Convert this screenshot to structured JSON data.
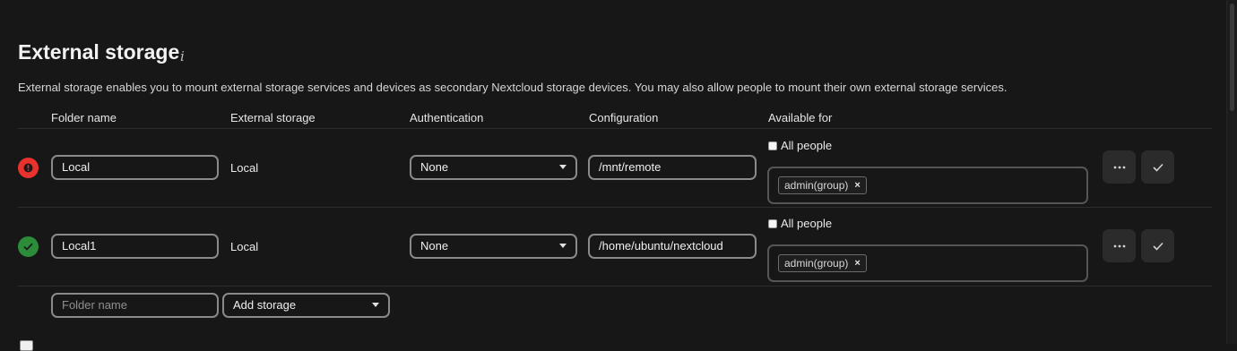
{
  "section": {
    "title": "External storage",
    "info_icon": "i",
    "description": "External storage enables you to mount external storage services and devices as secondary Nextcloud storage devices. You may also allow people to mount their own external storage services."
  },
  "columns": {
    "folder": "Folder name",
    "storage": "External storage",
    "auth": "Authentication",
    "config": "Configuration",
    "available": "Available for"
  },
  "mounts": [
    {
      "status": "error",
      "status_icon": "exclamation-icon",
      "folder_name": "Local",
      "storage_type": "Local",
      "authentication": "None",
      "configuration": "/mnt/remote",
      "all_people_label": "All people",
      "all_people_checked": false,
      "applicable": [
        "admin(group)"
      ],
      "remove_tag": "×"
    },
    {
      "status": "ok",
      "status_icon": "checkmark-icon",
      "folder_name": "Local1",
      "storage_type": "Local",
      "authentication": "None",
      "configuration": "/home/ubuntu/nextcloud",
      "all_people_label": "All people",
      "all_people_checked": false,
      "applicable": [
        "admin(group)"
      ],
      "remove_tag": "×"
    }
  ],
  "new_mount": {
    "folder_placeholder": "Folder name",
    "add_storage_label": "Add storage"
  },
  "colors": {
    "background": "#171717",
    "error": "#e9322d",
    "success": "#2d8c3a"
  }
}
